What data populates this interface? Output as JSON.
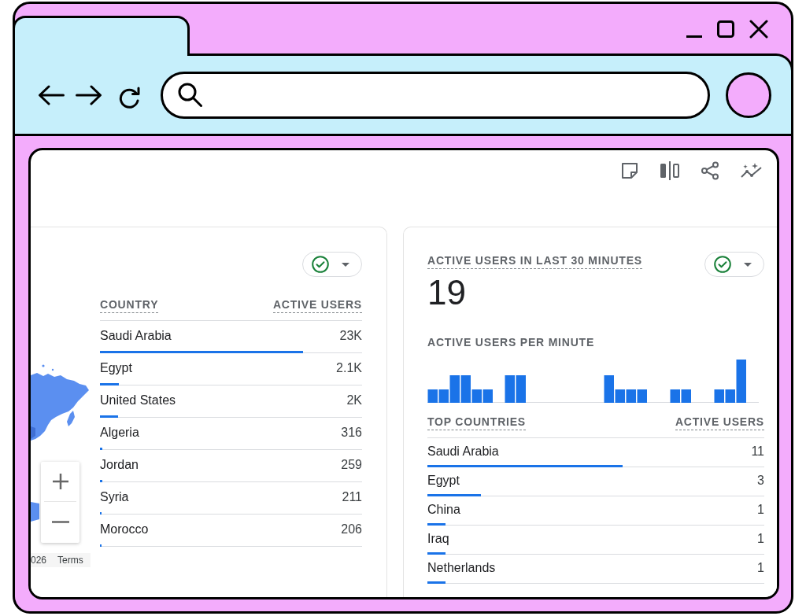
{
  "map_card": {
    "map": {
      "attribution": "026",
      "terms_link": "Terms"
    },
    "table": {
      "columns": [
        "COUNTRY",
        "ACTIVE USERS"
      ],
      "rows": [
        {
          "country": "Saudi Arabia",
          "active_users": "23K",
          "level": 0.775
        },
        {
          "country": "Egypt",
          "active_users": "2.1K",
          "level": 0.072
        },
        {
          "country": "United States",
          "active_users": "2K",
          "level": 0.069
        },
        {
          "country": "Algeria",
          "active_users": "316",
          "level": 0.008
        },
        {
          "country": "Jordan",
          "active_users": "259",
          "level": 0.008
        },
        {
          "country": "Syria",
          "active_users": "211",
          "level": 0.007
        },
        {
          "country": "Morocco",
          "active_users": "206",
          "level": 0.007
        }
      ]
    }
  },
  "realtime_card": {
    "title": "ACTIVE USERS IN LAST 30 MINUTES",
    "value": "19",
    "chart_title": "ACTIVE USERS PER MINUTE",
    "table": {
      "columns": [
        "TOP COUNTRIES",
        "ACTIVE USERS"
      ],
      "rows": [
        {
          "country": "Saudi Arabia",
          "active_users": "11",
          "level": 0.58
        },
        {
          "country": "Egypt",
          "active_users": "3",
          "level": 0.158
        },
        {
          "country": "China",
          "active_users": "1",
          "level": 0.053
        },
        {
          "country": "Iraq",
          "active_users": "1",
          "level": 0.053
        },
        {
          "country": "Netherlands",
          "active_users": "1",
          "level": 0.053
        }
      ]
    }
  }
}
